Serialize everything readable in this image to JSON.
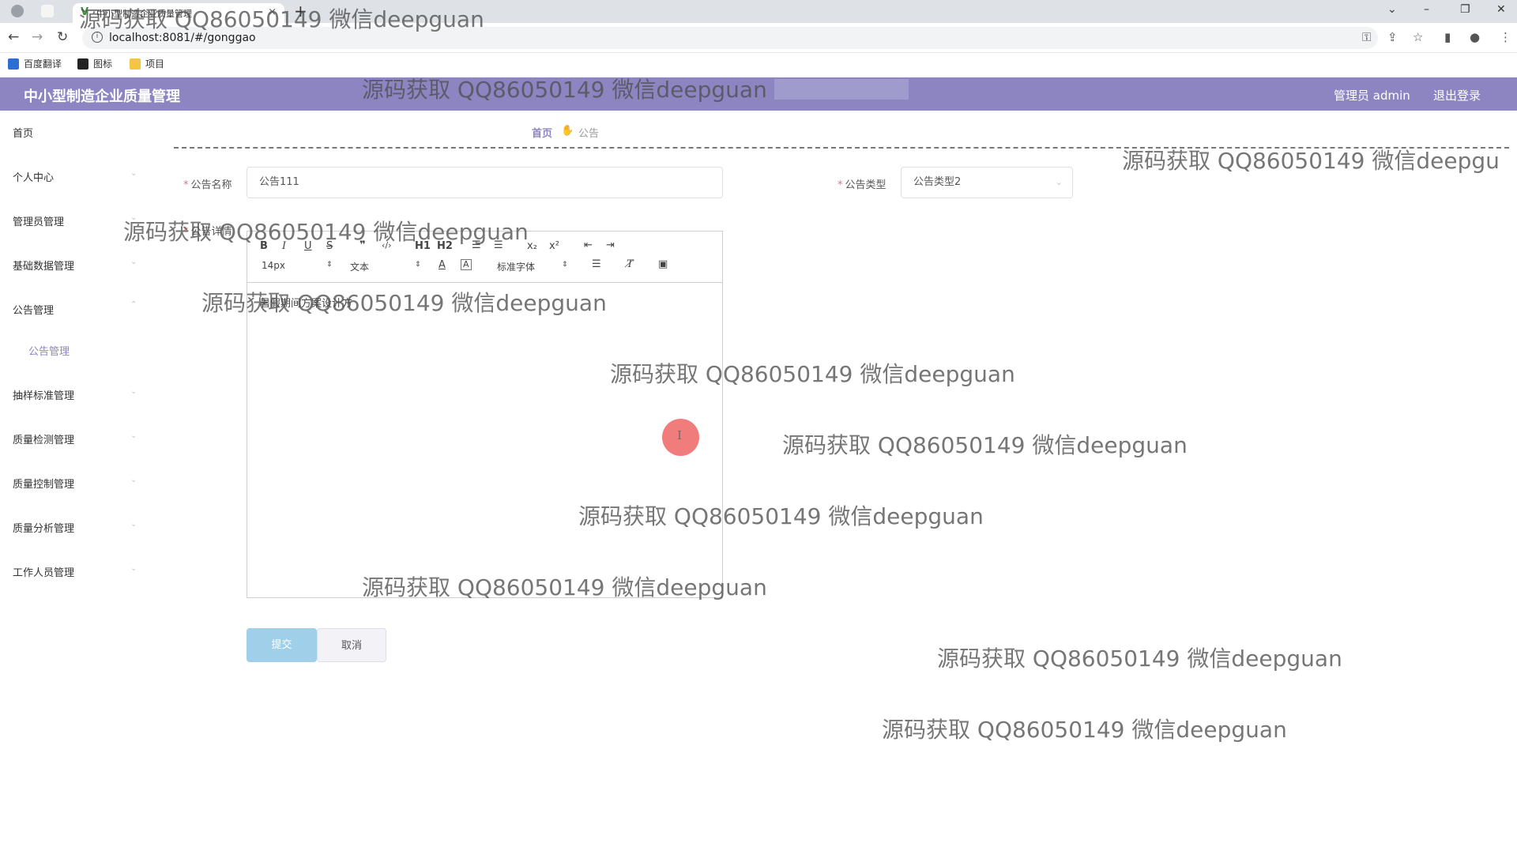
{
  "browser": {
    "tab_title": "中小型制造企业质量管理",
    "url": "localhost:8081/#/gonggao",
    "bookmarks": [
      "百度翻译",
      "图标",
      "项目"
    ]
  },
  "header": {
    "app_title": "中小型制造企业质量管理",
    "user_label": "管理员 admin",
    "logout_label": "退出登录"
  },
  "sidebar": {
    "items": [
      {
        "label": "首页"
      },
      {
        "label": "个人中心"
      },
      {
        "label": "管理员管理"
      },
      {
        "label": "基础数据管理"
      },
      {
        "label": "公告管理"
      },
      {
        "label": "抽样标准管理"
      },
      {
        "label": "质量检测管理"
      },
      {
        "label": "质量控制管理"
      },
      {
        "label": "质量分析管理"
      },
      {
        "label": "工作人员管理"
      }
    ],
    "submenu": {
      "label": "公告管理"
    }
  },
  "breadcrumb": {
    "home": "首页",
    "current": "公告"
  },
  "form": {
    "name_label": "公告名称",
    "name_value": "公告111",
    "type_label": "公告类型",
    "type_value": "公告类型2",
    "detail_label": "公告详情",
    "editor": {
      "font_size": "14px",
      "header_select": "文本",
      "font_family": "标准字体",
      "h1": "H1",
      "h2": "H2",
      "sub": "x₂",
      "sup": "x²",
      "body_text": "暑假期间方案设计方"
    },
    "submit_label": "提交",
    "cancel_label": "取消"
  },
  "watermark": {
    "text": "源码获取 QQ86050149 微信deepguan",
    "text_cut": "源码获取 QQ86050149 微信deepgu"
  },
  "colors": {
    "header_bg": "#8c85c2",
    "accent": "#8c85c2",
    "primary_button": "#a0cfea"
  }
}
